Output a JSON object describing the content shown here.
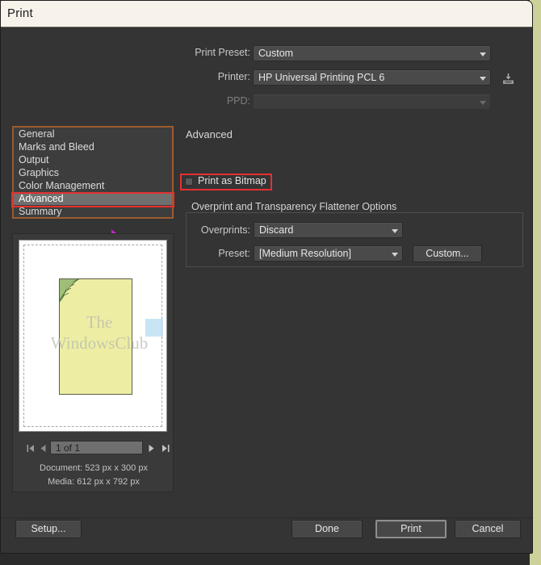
{
  "window": {
    "title": "Print"
  },
  "form": {
    "print_preset": {
      "label": "Print Preset:",
      "value": "Custom",
      "save_icon": "save-preset-icon"
    },
    "printer": {
      "label": "Printer:",
      "value": "HP Universal Printing PCL 6"
    },
    "ppd": {
      "label": "PPD:",
      "value": "",
      "disabled": true
    }
  },
  "sidebar": {
    "items": [
      {
        "label": "General",
        "selected": false
      },
      {
        "label": "Marks and Bleed",
        "selected": false
      },
      {
        "label": "Output",
        "selected": false
      },
      {
        "label": "Graphics",
        "selected": false
      },
      {
        "label": "Color Management",
        "selected": false
      },
      {
        "label": "Advanced",
        "selected": true
      },
      {
        "label": "Summary",
        "selected": false
      }
    ],
    "border_color": "#9c5b2e",
    "highlight_color": "#e53030"
  },
  "panel": {
    "title": "Advanced",
    "print_as_bitmap": {
      "label": "Print as Bitmap",
      "checked": false
    },
    "group": {
      "legend": "Overprint and Transparency Flattener Options",
      "overprints": {
        "label": "Overprints:",
        "value": "Discard"
      },
      "preset": {
        "label": "Preset:",
        "value": "[Medium Resolution]"
      },
      "custom_button": "Custom..."
    }
  },
  "preview": {
    "watermark_line1": "The",
    "watermark_line2": "WindowsClub",
    "nav": {
      "first": "first-page-icon",
      "prev": "previous-page-icon",
      "page_value": "1 of 1",
      "next": "next-page-icon",
      "last": "last-page-icon"
    },
    "document_size": "Document: 523 px x 300 px",
    "media_size": "Media: 612 px x 792 px"
  },
  "footer": {
    "setup": "Setup...",
    "done": "Done",
    "print": "Print",
    "cancel": "Cancel"
  }
}
